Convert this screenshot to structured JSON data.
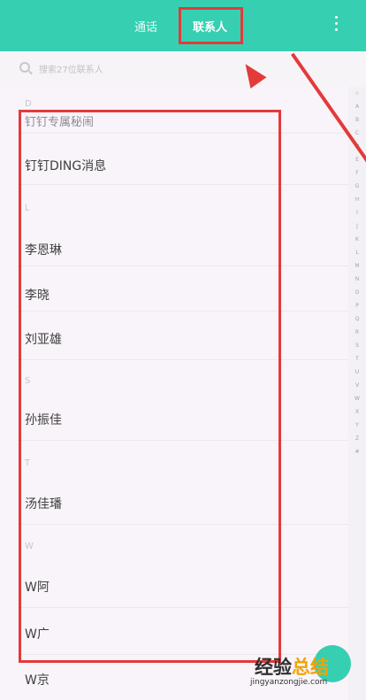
{
  "tabs": {
    "calls": "通话",
    "contacts": "联系人"
  },
  "search": {
    "placeholder": "搜索27位联系人"
  },
  "sections": {
    "d": "D",
    "l": "L",
    "s": "S",
    "t": "T",
    "w": "W"
  },
  "contacts": {
    "d1": "钉钉专属秘闹",
    "d2": "钉钉DING消息",
    "l1": "李恩琳",
    "l2": "李晓",
    "l3": "刘亚雄",
    "s1": "孙振佳",
    "t1": "汤佳璠",
    "w1": "W阿",
    "w2": "W广",
    "w3": "W京"
  },
  "index_letters": [
    "☆",
    "A",
    "B",
    "C",
    "D",
    "E",
    "F",
    "G",
    "H",
    "I",
    "J",
    "K",
    "L",
    "M",
    "N",
    "O",
    "P",
    "Q",
    "R",
    "S",
    "T",
    "U",
    "V",
    "W",
    "X",
    "Y",
    "Z",
    "#"
  ],
  "watermark": {
    "main_a": "经验",
    "main_b": "总结",
    "url": "jingyanzongjie.com"
  },
  "colors": {
    "accent": "#36cfb1",
    "annotation": "#e33a3a"
  }
}
